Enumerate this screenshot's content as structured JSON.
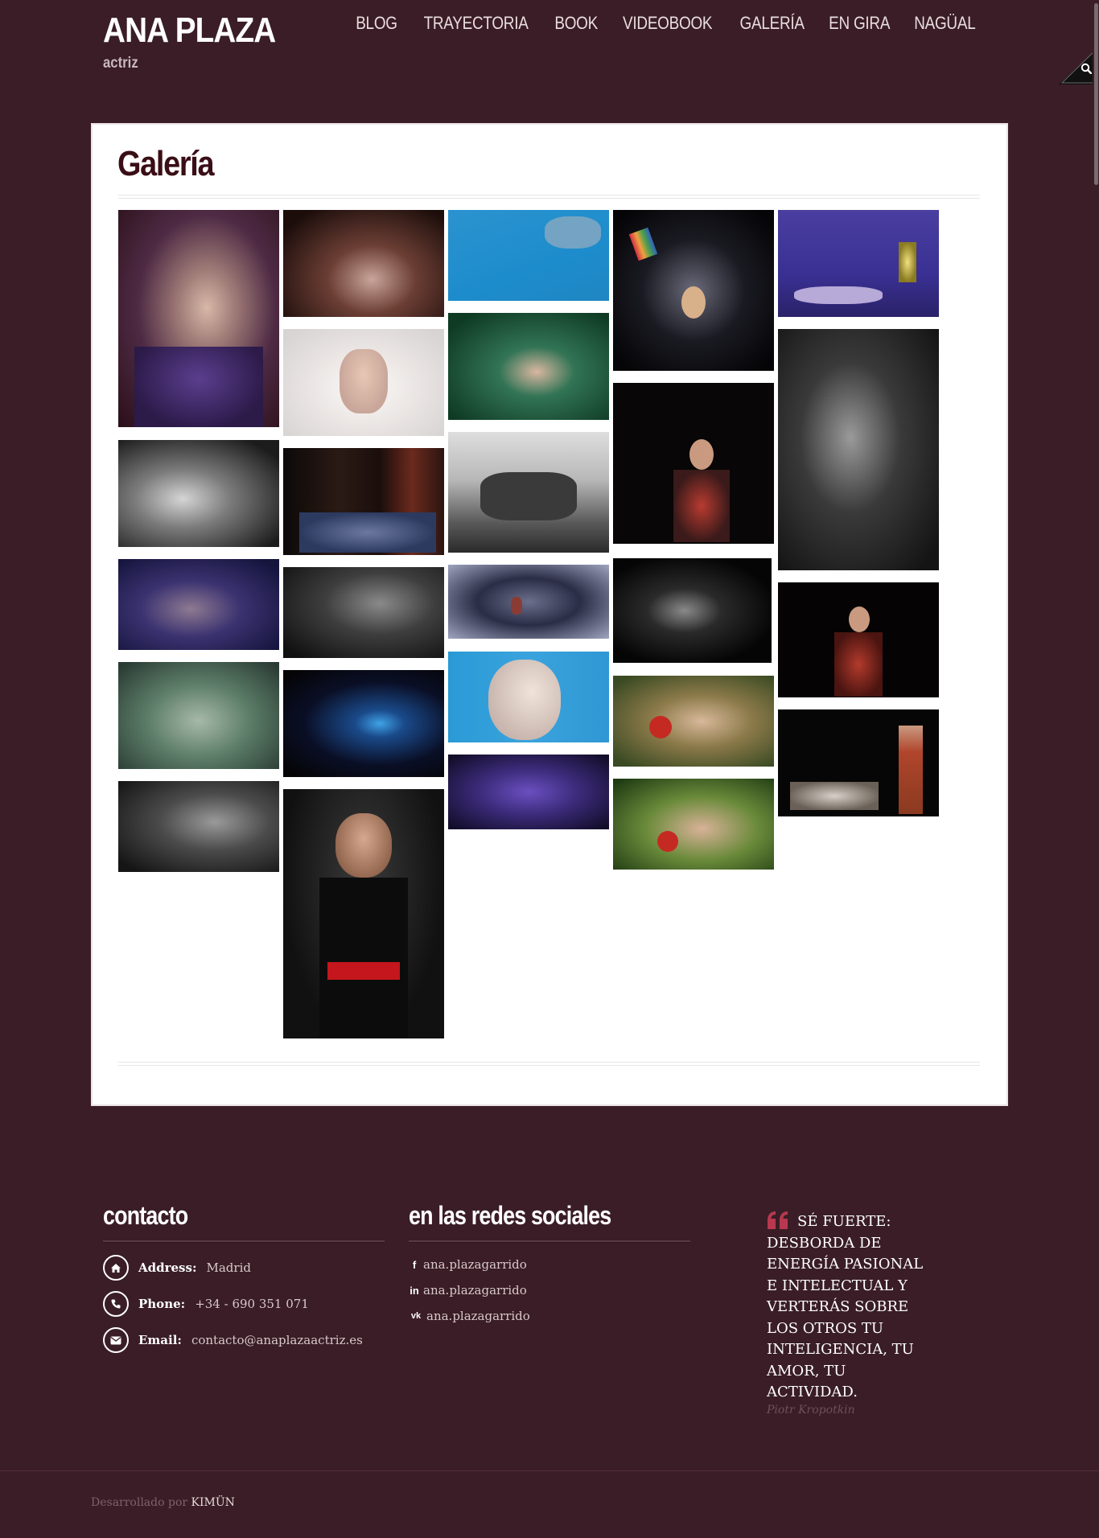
{
  "site": {
    "title": "ANA PLAZA",
    "tagline": "actriz"
  },
  "nav": {
    "items": [
      "BLOG",
      "TRAYECTORIA",
      "BOOK",
      "VIDEOBOOK",
      "GALERÍA",
      "EN GIRA",
      "NAGÜAL"
    ]
  },
  "page": {
    "title": "Galería"
  },
  "footer": {
    "contact": {
      "heading": "contacto",
      "address_label": "Address:",
      "address_value": "Madrid",
      "phone_label": "Phone:",
      "phone_value": "+34 - 690 351 071",
      "email_label": "Email:",
      "email_value": "contacto@anaplazaactriz.es"
    },
    "social": {
      "heading": "en las redes sociales",
      "facebook": "ana.plazagarrido",
      "linkedin": "ana.plazagarrido",
      "vk": "ana.plazagarrido",
      "vk_icon_text": "vk"
    },
    "quote": {
      "text": "SÉ FUERTE: DESBORDA DE ENERGÍA PASIONAL E INTELECTUAL Y VERTERÁS SOBRE LOS OTROS TU INTELIGENCIA, TU AMOR, TU ACTIVIDAD.",
      "author": "Piotr Kropotkin"
    }
  },
  "credits": {
    "prefix": "Desarrollado por",
    "company": "KIMÜN"
  },
  "colors": {
    "background": "#3a1d26",
    "card": "#ffffff",
    "title": "#3a0e16",
    "quote_accent": "#b8384f"
  }
}
